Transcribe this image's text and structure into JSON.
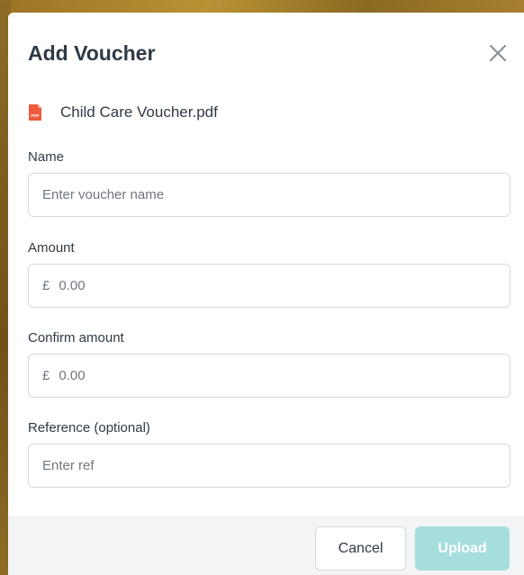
{
  "modal": {
    "title": "Add Voucher",
    "close_icon": "close-icon"
  },
  "file": {
    "icon": "pdf-file-icon",
    "icon_label": "PDF",
    "name": "Child Care Voucher.pdf"
  },
  "fields": {
    "name": {
      "label": "Name",
      "placeholder": "Enter voucher name",
      "value": ""
    },
    "amount": {
      "label": "Amount",
      "currency": "£",
      "placeholder": "0.00",
      "value": ""
    },
    "confirm_amount": {
      "label": "Confirm amount",
      "currency": "£",
      "placeholder": "0.00",
      "value": ""
    },
    "reference": {
      "label": "Reference (optional)",
      "placeholder": "Enter ref",
      "value": ""
    }
  },
  "footer": {
    "cancel_label": "Cancel",
    "upload_label": "Upload"
  },
  "colors": {
    "primary_disabled": "#a6dede",
    "pdf_red": "#f05a3a",
    "text": "#2e3a46"
  }
}
